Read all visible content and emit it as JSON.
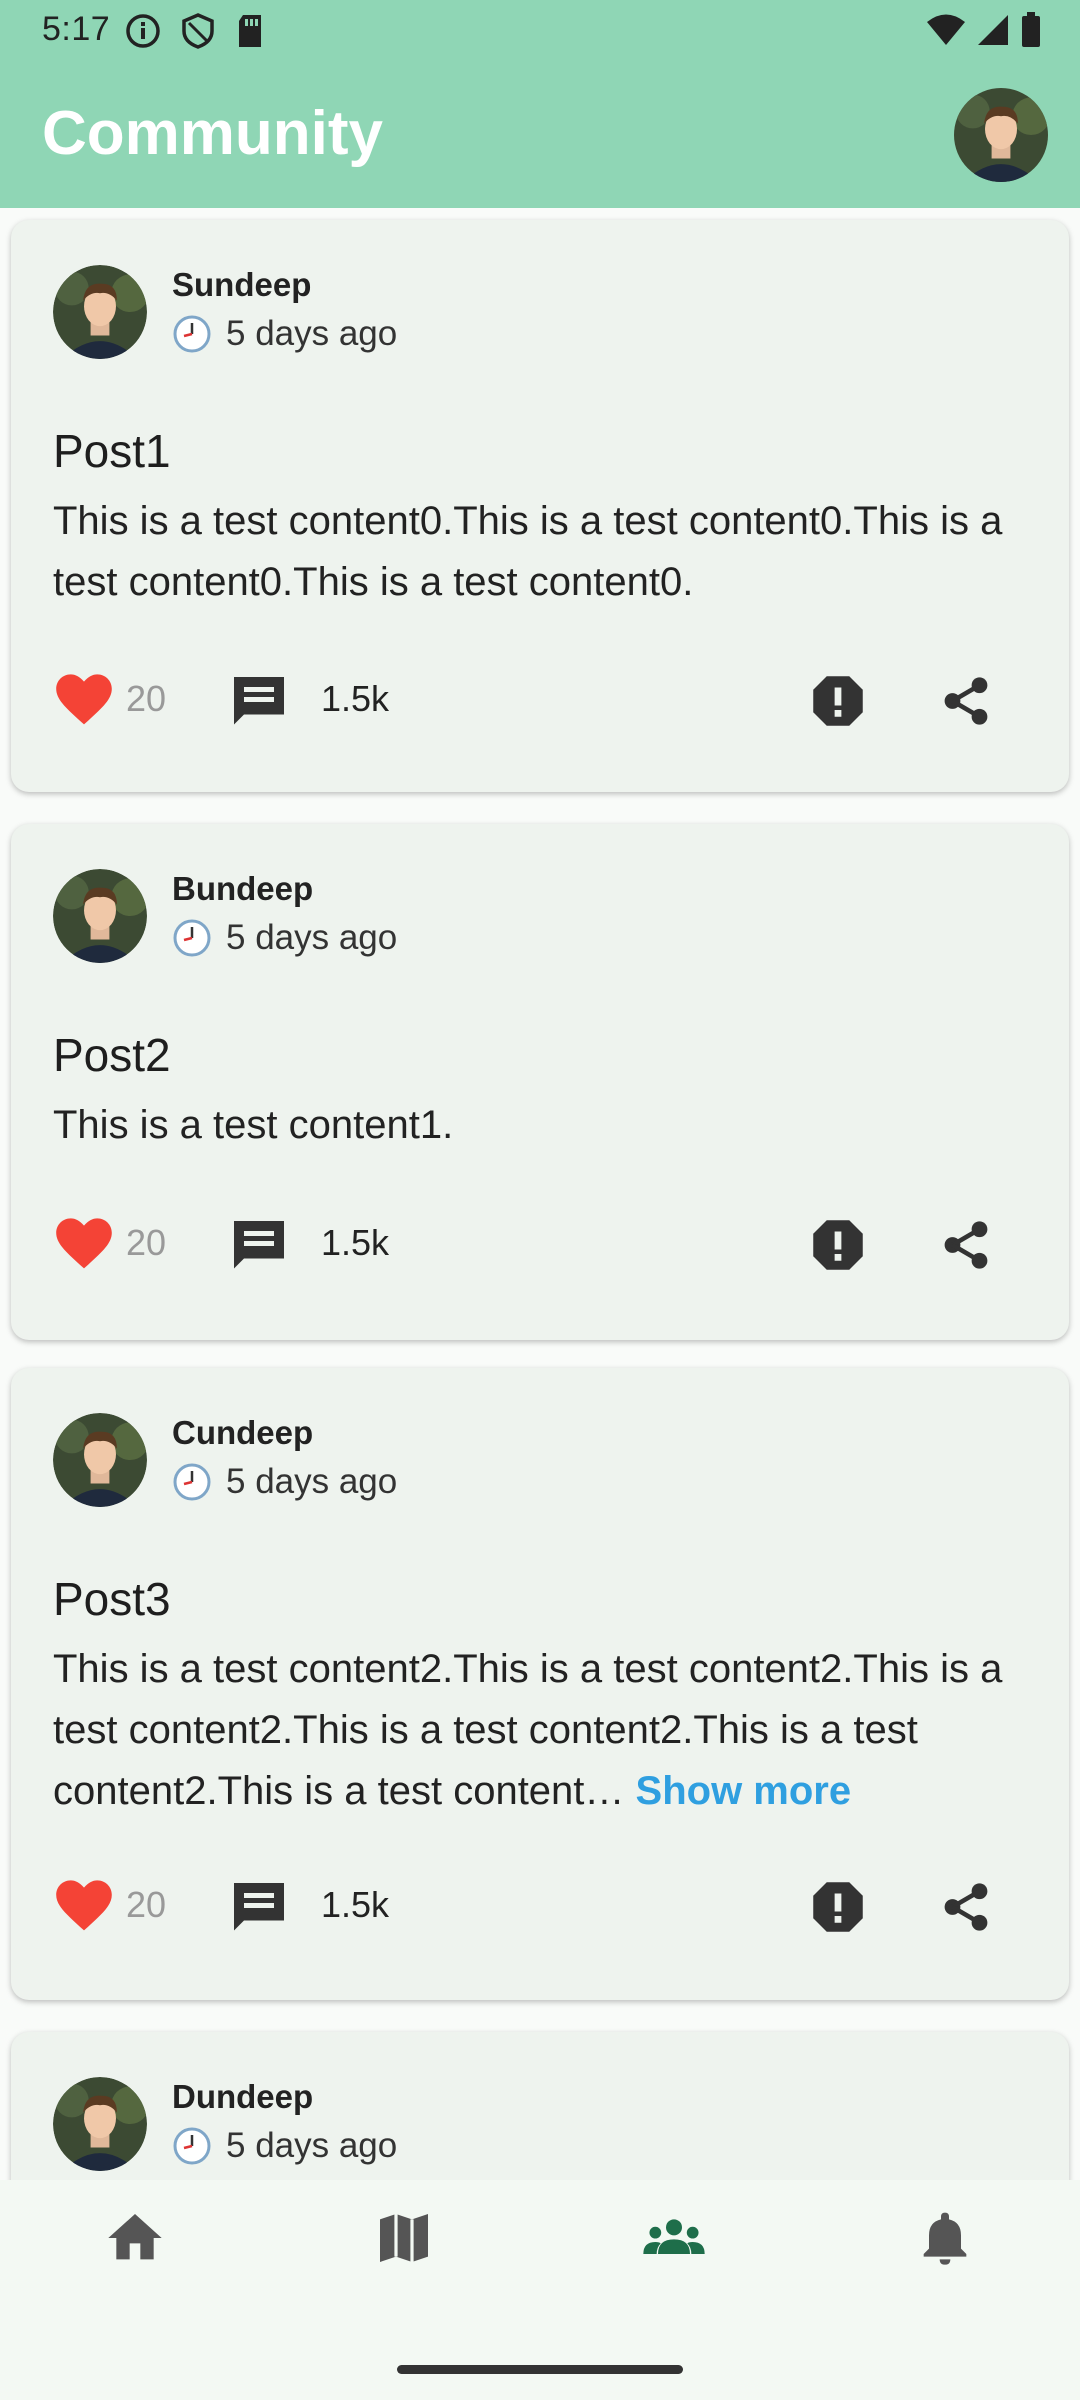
{
  "status_bar": {
    "time": "5:17"
  },
  "app_bar": {
    "title": "Community"
  },
  "posts": [
    {
      "author": "Sundeep",
      "time": "5 days ago",
      "title": "Post1",
      "body": "This is a test content0.This is a test content0.This is a test content0.This is a test content0.",
      "likes": "20",
      "comments": "1.5k"
    },
    {
      "author": "Bundeep",
      "time": "5 days ago",
      "title": "Post2",
      "body": "This is a test content1.",
      "likes": "20",
      "comments": "1.5k"
    },
    {
      "author": "Cundeep",
      "time": "5 days ago",
      "title": "Post3",
      "body": "This is a test content2.This is a test content2.This is a test content2.This is a test content2.This is a test content2.This is a test content…",
      "show_more": "Show more",
      "likes": "20",
      "comments": "1.5k"
    },
    {
      "author": "Dundeep",
      "time": "5 days ago"
    }
  ],
  "bottom_nav": [
    {
      "icon": "home-icon",
      "active": false
    },
    {
      "icon": "map-icon",
      "active": false
    },
    {
      "icon": "groups-icon",
      "active": true
    },
    {
      "icon": "notifications-icon",
      "active": false
    }
  ],
  "colors": {
    "app_bar": "#8fd6b5",
    "like": "#f44336",
    "link": "#2f9fe0",
    "nav_active": "#1e6e4a",
    "nav_inactive": "#555555"
  }
}
